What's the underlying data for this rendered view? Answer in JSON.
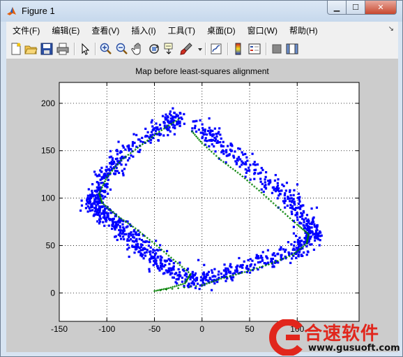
{
  "window": {
    "title": "Figure 1",
    "minimize_glyph": "▁",
    "maximize_glyph": "☐",
    "close_glyph": "✕"
  },
  "menubar": {
    "items": [
      "文件(F)",
      "编辑(E)",
      "查看(V)",
      "插入(I)",
      "工具(T)",
      "桌面(D)",
      "窗口(W)",
      "帮助(H)"
    ],
    "overflow_glyph": "↘"
  },
  "toolbar": {
    "buttons": [
      "new-figure-icon",
      "open-file-icon",
      "save-icon",
      "print-icon",
      "select-arrow-icon",
      "zoom-in-icon",
      "zoom-out-icon",
      "pan-hand-icon",
      "rotate-3d-icon",
      "data-cursor-icon",
      "brush-icon",
      "link-plot-icon",
      "colorbar-icon",
      "legend-icon",
      "hide-plot-tools-icon",
      "show-plot-tools-icon"
    ]
  },
  "colors": {
    "scan_points": "#0000ff",
    "trajectory": "#008000",
    "axes_bg": "#ffffff",
    "figure_bg": "#cccccc"
  },
  "chart_data": {
    "type": "scatter",
    "title": "Map before least-squares alignment",
    "xlabel": "",
    "ylabel": "",
    "xlim": [
      -150,
      165
    ],
    "ylim": [
      -30,
      222
    ],
    "xticks": [
      -150,
      -100,
      -50,
      0,
      50,
      100
    ],
    "yticks": [
      0,
      50,
      100,
      150,
      200
    ],
    "grid": "dotted",
    "series": [
      {
        "marker": "point",
        "color": "#0000ff",
        "outline": [
          [
            -23,
            185
          ],
          [
            -40,
            178
          ],
          [
            -80,
            148
          ],
          [
            -100,
            126
          ],
          [
            -110,
            105
          ],
          [
            -115,
            92
          ],
          [
            -100,
            80
          ],
          [
            -80,
            65
          ],
          [
            -60,
            45
          ],
          [
            -40,
            28
          ],
          [
            -10,
            12
          ],
          [
            20,
            20
          ],
          [
            60,
            32
          ],
          [
            100,
            45
          ],
          [
            118,
            58
          ],
          [
            112,
            70
          ],
          [
            95,
            100
          ],
          [
            60,
            125
          ],
          [
            20,
            155
          ],
          [
            -5,
            178
          ]
        ]
      },
      {
        "marker": "cross",
        "color": "#008000",
        "points": [
          [
            -25,
            183
          ],
          [
            -45,
            170
          ],
          [
            -65,
            155
          ],
          [
            -85,
            140
          ],
          [
            -100,
            122
          ],
          [
            -108,
            105
          ],
          [
            -105,
            95
          ],
          [
            -90,
            82
          ],
          [
            -70,
            68
          ],
          [
            -50,
            52
          ],
          [
            -30,
            35
          ],
          [
            -12,
            20
          ],
          [
            -18,
            10
          ],
          [
            -35,
            5
          ],
          [
            -50,
            2
          ],
          [
            0,
            8
          ],
          [
            20,
            15
          ],
          [
            45,
            22
          ],
          [
            70,
            30
          ],
          [
            95,
            40
          ],
          [
            110,
            52
          ],
          [
            112,
            62
          ],
          [
            100,
            72
          ],
          [
            80,
            90
          ],
          [
            60,
            108
          ],
          [
            40,
            125
          ],
          [
            20,
            140
          ],
          [
            0,
            158
          ],
          [
            -12,
            172
          ]
        ]
      }
    ]
  },
  "watermark": {
    "text": "合速软件",
    "url": "www.gusuoft.com"
  }
}
